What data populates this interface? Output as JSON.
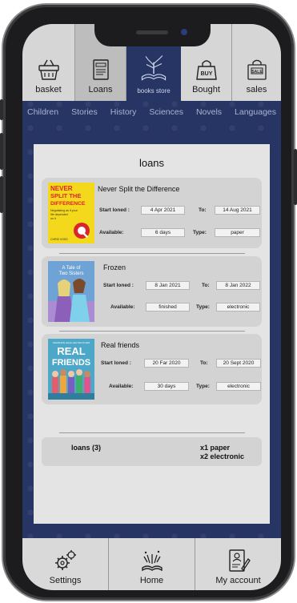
{
  "top_tabs": [
    {
      "label": "basket",
      "icon": "basket-icon"
    },
    {
      "label": "Loans",
      "icon": "loans-book-icon"
    },
    {
      "label": "books store",
      "icon": "book-tree-logo-icon"
    },
    {
      "label": "Bought",
      "icon": "buy-bag-icon"
    },
    {
      "label": "sales",
      "icon": "sale-bag-icon"
    }
  ],
  "categories": [
    "Children",
    "Stories",
    "History",
    "Sciences",
    "Novels",
    "Languages"
  ],
  "loans": {
    "title": "loans",
    "labels": {
      "start": "Start loned :",
      "to": "To:",
      "available": "Available:",
      "type": "Type:"
    },
    "items": [
      {
        "title": "Never Split the Difference",
        "start": "4 Apr 2021",
        "end": "14 Aug 2021",
        "available": "6 days",
        "type": "paper",
        "cover": {
          "l1": "NEVER",
          "l2": "SPLIT THE",
          "l3": "DIFFERENCE",
          "l4": "Negotiating as if your",
          "l5": "life depended",
          "l6": "on it",
          "author": "CHRIS VOSS",
          "bg": "#f4d81c",
          "accent": "#d9262c"
        }
      },
      {
        "title": "Frozen",
        "start": "8 Jan 2021",
        "end": "8 Jan 2022",
        "available": "finished",
        "type": "electronic",
        "cover": {
          "l1": "A Tale of",
          "l2": "Two Sisters",
          "bg": "#6fa3d6"
        }
      },
      {
        "title": "Real friends",
        "start": "20 Far 2020",
        "end": "20 Sept 2020",
        "available": "30 days",
        "type": "electronic",
        "cover": {
          "top": "SHANNON HALE  LEUYEN PHAM",
          "l1": "REAL",
          "l2": "FRIENDS",
          "bg": "#4da7c9"
        }
      }
    ],
    "summary": {
      "count": "loans (3)",
      "paper": "x1 paper",
      "electronic": "x2 electronic"
    }
  },
  "bottom_nav": [
    {
      "label": "Settings",
      "icon": "gears-icon"
    },
    {
      "label": "Home",
      "icon": "open-book-sparkle-icon"
    },
    {
      "label": "My account",
      "icon": "account-form-icon"
    }
  ],
  "colors": {
    "screen_bg": "#273565",
    "panel": "#e4e4e4",
    "card": "#d3d3d3",
    "tab": "#d6d6d6"
  }
}
